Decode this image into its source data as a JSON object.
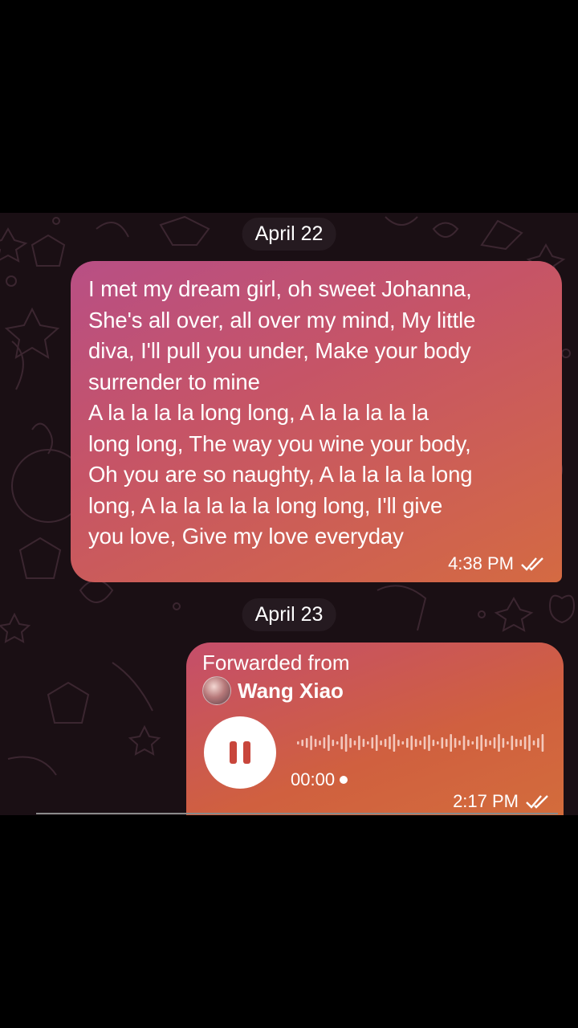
{
  "dates": {
    "first": "April 22",
    "second": "April 23"
  },
  "message1": {
    "text": "I met my dream girl, oh sweet Johanna,\nShe's all over, all over my mind, My little\ndiva, I'll pull you under, Make your body\nsurrender to mine\nA la la la la long long, A la la la la la\nlong long, The way you wine your body,\nOh you are so naughty, A la la la la long\nlong, A la la la la la long long, I'll give\nyou love, Give my love everyday",
    "time": "4:38 PM",
    "status_icon": "double-check-icon"
  },
  "message2": {
    "forwarded_label": "Forwarded from",
    "forwarded_name": "Wang Xiao",
    "duration": "00:00",
    "time": "2:17 PM",
    "status_icon": "double-check-icon",
    "player_icon": "pause-icon"
  },
  "colors": {
    "accent_pause": "#c8463c",
    "bubble_pink": "#b84f85",
    "bubble_orange": "#d46a42"
  }
}
